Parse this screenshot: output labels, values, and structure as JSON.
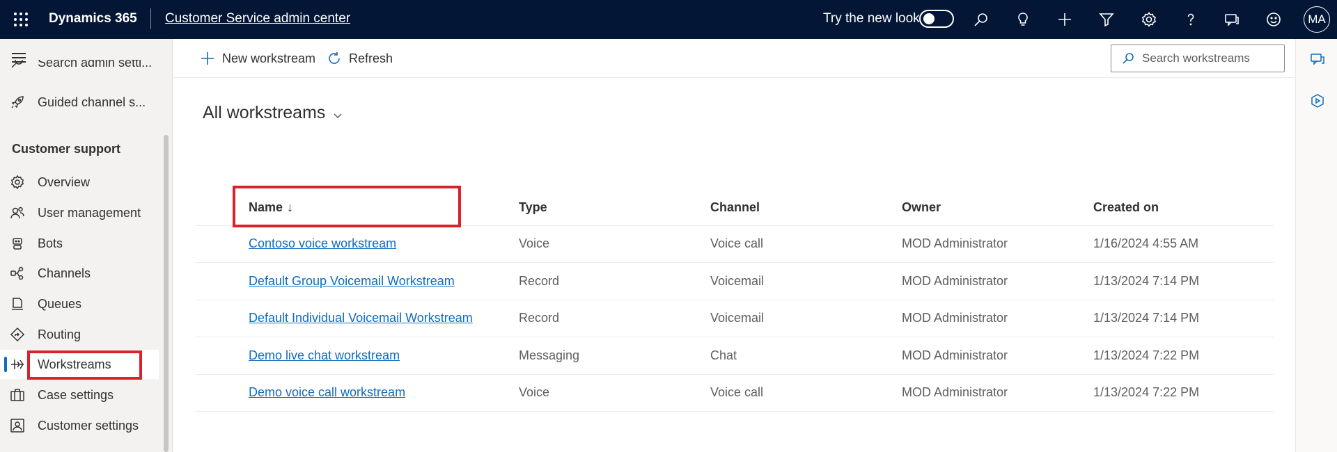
{
  "topbar": {
    "brand": "Dynamics 365",
    "app_name": "Customer Service admin center",
    "try_new_look": "Try the new look",
    "avatar_initials": "MA"
  },
  "sidebar": {
    "partial_items": [
      {
        "label": "Search admin setti...",
        "icon": "search-icon"
      },
      {
        "label": "Guided channel s...",
        "icon": "rocket-icon"
      }
    ],
    "section_title": "Customer support",
    "items": [
      {
        "label": "Overview",
        "icon": "gear-overview-icon"
      },
      {
        "label": "User management",
        "icon": "people-icon"
      },
      {
        "label": "Bots",
        "icon": "bot-icon"
      },
      {
        "label": "Channels",
        "icon": "channels-icon"
      },
      {
        "label": "Queues",
        "icon": "queue-icon"
      },
      {
        "label": "Routing",
        "icon": "routing-icon"
      },
      {
        "label": "Workstreams",
        "icon": "workstream-icon",
        "selected": true
      },
      {
        "label": "Case settings",
        "icon": "case-icon"
      },
      {
        "label": "Customer settings",
        "icon": "customer-icon"
      }
    ]
  },
  "commandbar": {
    "new_label": "New workstream",
    "refresh_label": "Refresh",
    "search_placeholder": "Search workstreams"
  },
  "view": {
    "title": "All workstreams"
  },
  "table": {
    "headers": [
      "Name",
      "Type",
      "Channel",
      "Owner",
      "Created on"
    ],
    "sort_arrow": "↓",
    "rows": [
      [
        "Contoso voice workstream",
        "Voice",
        "Voice call",
        "MOD Administrator",
        "1/16/2024 4:55 AM"
      ],
      [
        "Default Group Voicemail Workstream",
        "Record",
        "Voicemail",
        "MOD Administrator",
        "1/13/2024 7:14 PM"
      ],
      [
        "Default Individual Voicemail Workstream",
        "Record",
        "Voicemail",
        "MOD Administrator",
        "1/13/2024 7:14 PM"
      ],
      [
        "Demo live chat workstream",
        "Messaging",
        "Chat",
        "MOD Administrator",
        "1/13/2024 7:22 PM"
      ],
      [
        "Demo voice call workstream",
        "Voice",
        "Voice call",
        "MOD Administrator",
        "1/13/2024 7:22 PM"
      ]
    ]
  },
  "colors": {
    "topbar_bg": "#041636",
    "accent": "#0f6cbd",
    "highlight": "#d9222a"
  }
}
